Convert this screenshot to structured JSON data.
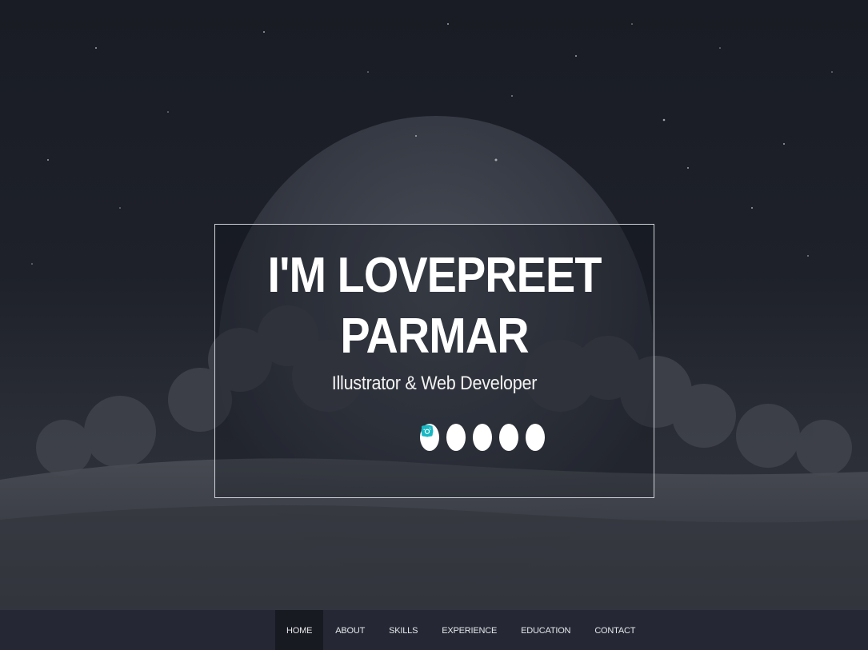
{
  "hero": {
    "name_line1": "I'M LOVEPREET",
    "name_line2": "PARMAR",
    "role": "Illustrator & Web Developer"
  },
  "social": [
    {
      "name": "twitter-icon"
    },
    {
      "name": "facebook-icon"
    },
    {
      "name": "linkedin-icon"
    },
    {
      "name": "instagram-icon"
    },
    {
      "name": "github-icon"
    }
  ],
  "colors": {
    "accent": "#17b8c4",
    "nav_bg": "#252834",
    "nav_active_bg": "#181a21"
  },
  "nav": {
    "items": [
      "HOME",
      "ABOUT",
      "SKILLS",
      "EXPERIENCE",
      "EDUCATION",
      "CONTACT"
    ],
    "active": "HOME"
  }
}
